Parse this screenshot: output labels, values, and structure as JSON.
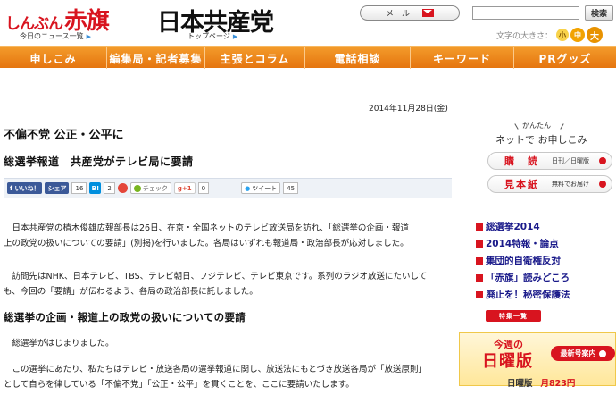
{
  "header": {
    "logo_small": "しんぶん",
    "logo_big": "赤旗",
    "news_link": "今日のニュース一覧",
    "jcp_logo": "日本共産党",
    "top_link": "トップページ",
    "mail_label": "メール",
    "search_button": "検索",
    "fontsize_label": "文字の大きさ：",
    "fontsize_small": "小",
    "fontsize_medium": "中",
    "fontsize_large": "大"
  },
  "nav": [
    {
      "label": "申しこみ",
      "w": 120
    },
    {
      "label": "編集局・記者募集",
      "w": 110
    },
    {
      "label": "主張とコラム",
      "w": 112
    },
    {
      "label": "電話相談",
      "w": 118
    },
    {
      "label": "キーワード",
      "w": 116
    },
    {
      "label": "PRグッズ",
      "w": 114
    }
  ],
  "article": {
    "date": "2014年11月28日(金)",
    "title": "不偏不党 公正・公平に",
    "subtitle": "総選挙報道　共産党がテレビ局に要請",
    "p1_l1": "　日本共産党の植木俊雄広報部長は26日、在京・全国ネットのテレビ放送局を訪れ、「総選挙の企画・報道",
    "p1_l2": "上の政党の扱いについての要請」(別掲)を行いました。各局はいずれも報道局・政治部長が応対しました。",
    "p2_l1": "　訪問先はNHK、日本テレビ、TBS、テレビ朝日、フジテレビ、テレビ東京です。系列のラジオ放送にたいして",
    "p2_l2": "も、今回の「要請」が伝わるよう、各局の政治部長に託しました。",
    "section_heading": "総選挙の企画・報道上の政党の扱いについての要請",
    "p3": "　総選挙がはじまりました。",
    "p4_l1": "　この選挙にあたり、私たちはテレビ・放送各局の選挙報道に関し、放送法にもとづき放送各局が「放送原則」",
    "p4_l2": "として自らを律している「不偏不党」「公正・公平」を貫くことを、ここに要請いたします。"
  },
  "social": {
    "like": "いいね！",
    "share": "シェア",
    "share_count": "16",
    "hatena": "B!",
    "hatena_count": "2",
    "check": "チェック",
    "gplus": "g+1",
    "gplus_count": "0",
    "tweet": "ツイート",
    "tweet_count": "45"
  },
  "sidebar": {
    "kantan": "かんたん",
    "apply": "ネットで お申しこみ",
    "daily_label": "購　読",
    "daily_sub": "日刊／日曜版",
    "sample_label": "見本紙",
    "sample_sub": "無料でお届け",
    "links": [
      "総選挙2014",
      "2014特報・論点",
      "集団的自衛権反対",
      "「赤旗」読みどころ",
      "廃止を！秘密保護法"
    ],
    "special": "特集一覧",
    "sunday_week": "今週の",
    "sunday_title": "日曜版",
    "sunday_latest": "最新号案内",
    "sunday_name": "日曜版",
    "sunday_price": "月823円"
  }
}
